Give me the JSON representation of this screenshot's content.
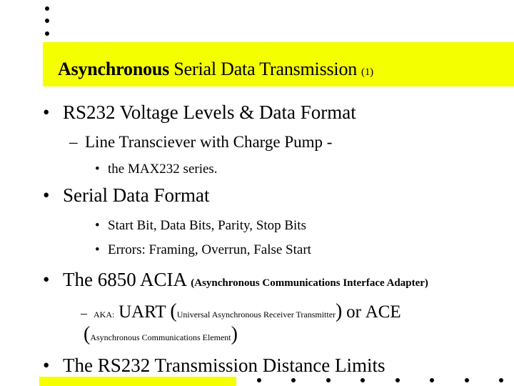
{
  "slide": {
    "title": {
      "bold_part": "Asynchronous",
      "rest": "Serial Data Transmission",
      "number": "(1)"
    },
    "bullet_glyph": "•",
    "dash_glyph": "–",
    "items": [
      {
        "level": 1,
        "text": "RS232 Voltage Levels & Data Format",
        "children": [
          {
            "level": 2,
            "text": "Line Transciever with Charge Pump -",
            "children": [
              {
                "level": 3,
                "text": "the MAX232 series."
              }
            ]
          }
        ]
      },
      {
        "level": 1,
        "text": "Serial Data Format",
        "children": [
          {
            "level": 3,
            "text": "Start Bit, Data Bits, Parity, Stop Bits"
          },
          {
            "level": 3,
            "text": "Errors: Framing, Overrun, False Start"
          }
        ]
      },
      {
        "level": 1,
        "text": "The 6850 ACIA",
        "note": "(Asynchronous Communications Interface Adapter)",
        "children": [
          {
            "level": 2,
            "prefix": "AKA:",
            "uart": "UART",
            "uart_expansion": "Universal Asynchronous Receiver Transmitter",
            "or": "or",
            "ace": "ACE",
            "ace_expansion": "Asynchronous Communications Element",
            "open_paren": "(",
            "close_paren": ")"
          }
        ]
      },
      {
        "level": 1,
        "text": "The RS232 Transmission Distance Limits"
      }
    ]
  },
  "colors": {
    "title_band": "#f4ff00",
    "background": "#ffffff",
    "text": "#000000"
  }
}
